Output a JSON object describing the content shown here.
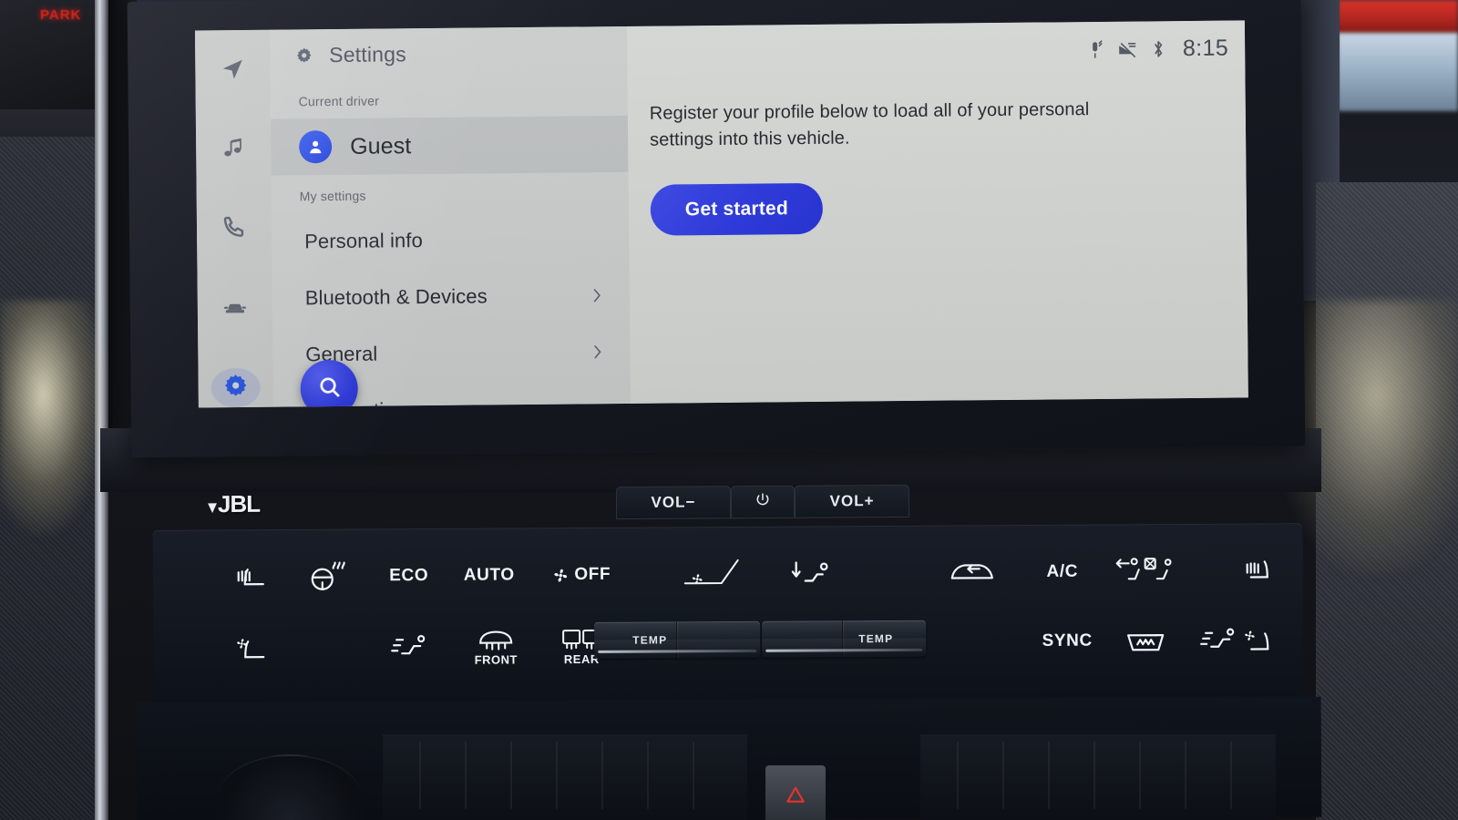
{
  "vehicle": {
    "cluster_indicator": "PARK",
    "audio_brand": "JBL"
  },
  "infotainment": {
    "statusbar": {
      "icons": [
        "mic-muted-icon",
        "signal-off-icon",
        "bluetooth-icon"
      ],
      "time": "8:15"
    },
    "rail": [
      {
        "name": "navigation",
        "icon": "navigation-arrow-icon",
        "active": false
      },
      {
        "name": "media",
        "icon": "music-note-icon",
        "active": false
      },
      {
        "name": "phone",
        "icon": "phone-icon",
        "active": false
      },
      {
        "name": "vehicle",
        "icon": "car-icon",
        "active": false
      },
      {
        "name": "settings",
        "icon": "gear-icon",
        "active": true
      }
    ],
    "settings_panel": {
      "header_icon": "gear-icon",
      "header_title": "Settings",
      "current_driver_label": "Current driver",
      "driver": {
        "avatar_icon": "person-icon",
        "name": "Guest"
      },
      "my_settings_label": "My settings",
      "menu": [
        {
          "label": "Personal info",
          "chevron": false
        },
        {
          "label": "Bluetooth & Devices",
          "chevron": true
        },
        {
          "label": "General",
          "chevron": true
        },
        {
          "label": "Notifications",
          "chevron": false
        }
      ],
      "search_icon": "search-icon"
    },
    "detail_panel": {
      "body": "Register your profile below to load all of your personal settings into this vehicle.",
      "cta_label": "Get started"
    },
    "colors": {
      "accent_blue": "#2a36dd",
      "screen_bg": "#d2d5d2",
      "rail_bg": "#c4c7c6",
      "list_bg": "#c9cccb",
      "selected_row": "#bcbfc0"
    }
  },
  "volume_bar": {
    "vol_down": "VOL−",
    "power_icon": "power-icon",
    "vol_up": "VOL+"
  },
  "climate": {
    "row1": [
      {
        "label": "",
        "icon": "heated-seat-driver-icon"
      },
      {
        "label": "",
        "icon": "heated-steering-wheel-icon"
      },
      {
        "label": "ECO",
        "icon": ""
      },
      {
        "label": "AUTO",
        "icon": ""
      },
      {
        "label": "OFF",
        "icon": "fan-icon"
      },
      {
        "label": "",
        "icon": "fan-speed-icon"
      },
      {
        "label": "",
        "icon": "airflow-down-icon"
      },
      {
        "label": "",
        "icon": "recirculation-icon"
      },
      {
        "label": "A/C",
        "icon": ""
      },
      {
        "label": "",
        "icon": "airflow-face-off-icon"
      },
      {
        "label": "",
        "icon": "heated-seat-passenger-icon"
      }
    ],
    "row2": [
      {
        "label": "",
        "icon": "cooled-seat-driver-icon"
      },
      {
        "label": "",
        "icon": "airflow-feet-icon"
      },
      {
        "label": "FRONT",
        "icon": "defrost-front-icon"
      },
      {
        "label": "REAR",
        "icon": "defrost-rear-icon"
      },
      {
        "label": "SYNC",
        "icon": ""
      },
      {
        "label": "",
        "icon": "defrost-windshield-icon"
      },
      {
        "label": "",
        "icon": "airflow-feet-passenger-icon"
      },
      {
        "label": "",
        "icon": "cooled-seat-passenger-icon"
      }
    ],
    "temp_left_label": "TEMP",
    "temp_right_label": "TEMP"
  },
  "console": {
    "hazard_icon": "hazard-triangle-icon"
  }
}
